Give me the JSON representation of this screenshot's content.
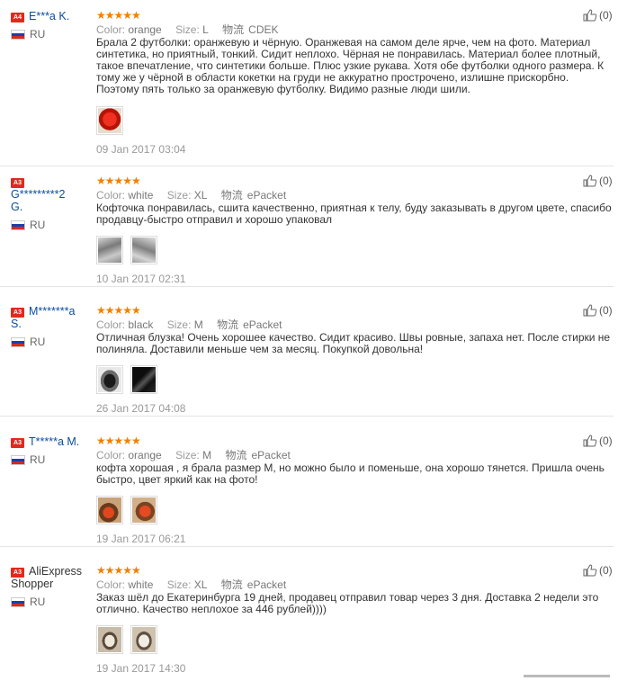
{
  "labels": {
    "color": "Color:",
    "size": "Size:",
    "shipping": "物流"
  },
  "rating_stars": "★★★★★",
  "reviews": [
    {
      "level": "A4",
      "name": "E***a K.",
      "name2": "",
      "country": "RU",
      "color": "orange",
      "size": "L",
      "shipping": "CDEK",
      "text": "Брала 2 футболки: оранжевую и чёрную. Оранжевая на самом деле ярче, чем на фото. Материал синтетика, но приятный, тонкий. Сидит неплохо. Чёрная не понравилась. Материал более плотный, такое впечатление, что синтетики больше. Плюс узкие рукава. Хотя обе футболки одного размера. К тому же у чёрной в области кокетки на груди не аккуратно прострочено, излишне прискорбно. Поэтому пять только за оранжевую футболку. Видимо разные люди шили.",
      "date": "09 Jan 2017 03:04",
      "likes": "(0)"
    },
    {
      "level": "A3",
      "name": "G*********2",
      "name2": "G.",
      "country": "RU",
      "color": "white",
      "size": "XL",
      "shipping": "ePacket",
      "text": "Кофточка понравилась, сшита качественно, приятная к телу, буду заказывать в другом цвете, спасибо продавцу-быстро отправил и хорошо упаковал",
      "date": "10 Jan 2017 02:31",
      "likes": "(0)"
    },
    {
      "level": "A3",
      "name": "M*******a",
      "name2": "S.",
      "country": "RU",
      "color": "black",
      "size": "M",
      "shipping": "ePacket",
      "text": "Отличная блузка! Очень хорошее качество. Сидит красиво. Швы ровные, запаха нет. После стирки не полиняла. Доставили меньше чем за месяц. Покупкой довольна!",
      "date": "26 Jan 2017 04:08",
      "likes": "(0)"
    },
    {
      "level": "A3",
      "name": "T*****a M.",
      "name2": "",
      "country": "RU",
      "color": "orange",
      "size": "M",
      "shipping": "ePacket",
      "text": "кофта хорошая , я брала размер М, но можно было и поменьше, она хорошо тянется. Пришла очень быстро, цвет яркий как на фото!",
      "date": "19 Jan 2017 06:21",
      "likes": "(0)"
    },
    {
      "level": "A3",
      "name": "AliExpress",
      "name2": "Shopper",
      "country": "RU",
      "color": "white",
      "size": "XL",
      "shipping": "ePacket",
      "text": "Заказ шёл до Екатеринбурга 19 дней, продавец отправил товар через 3 дня. Доставка 2 недели это отлично. Качество неплохое за 446 рублей))))",
      "date": "19 Jan 2017 14:30",
      "likes": "(0)"
    }
  ]
}
